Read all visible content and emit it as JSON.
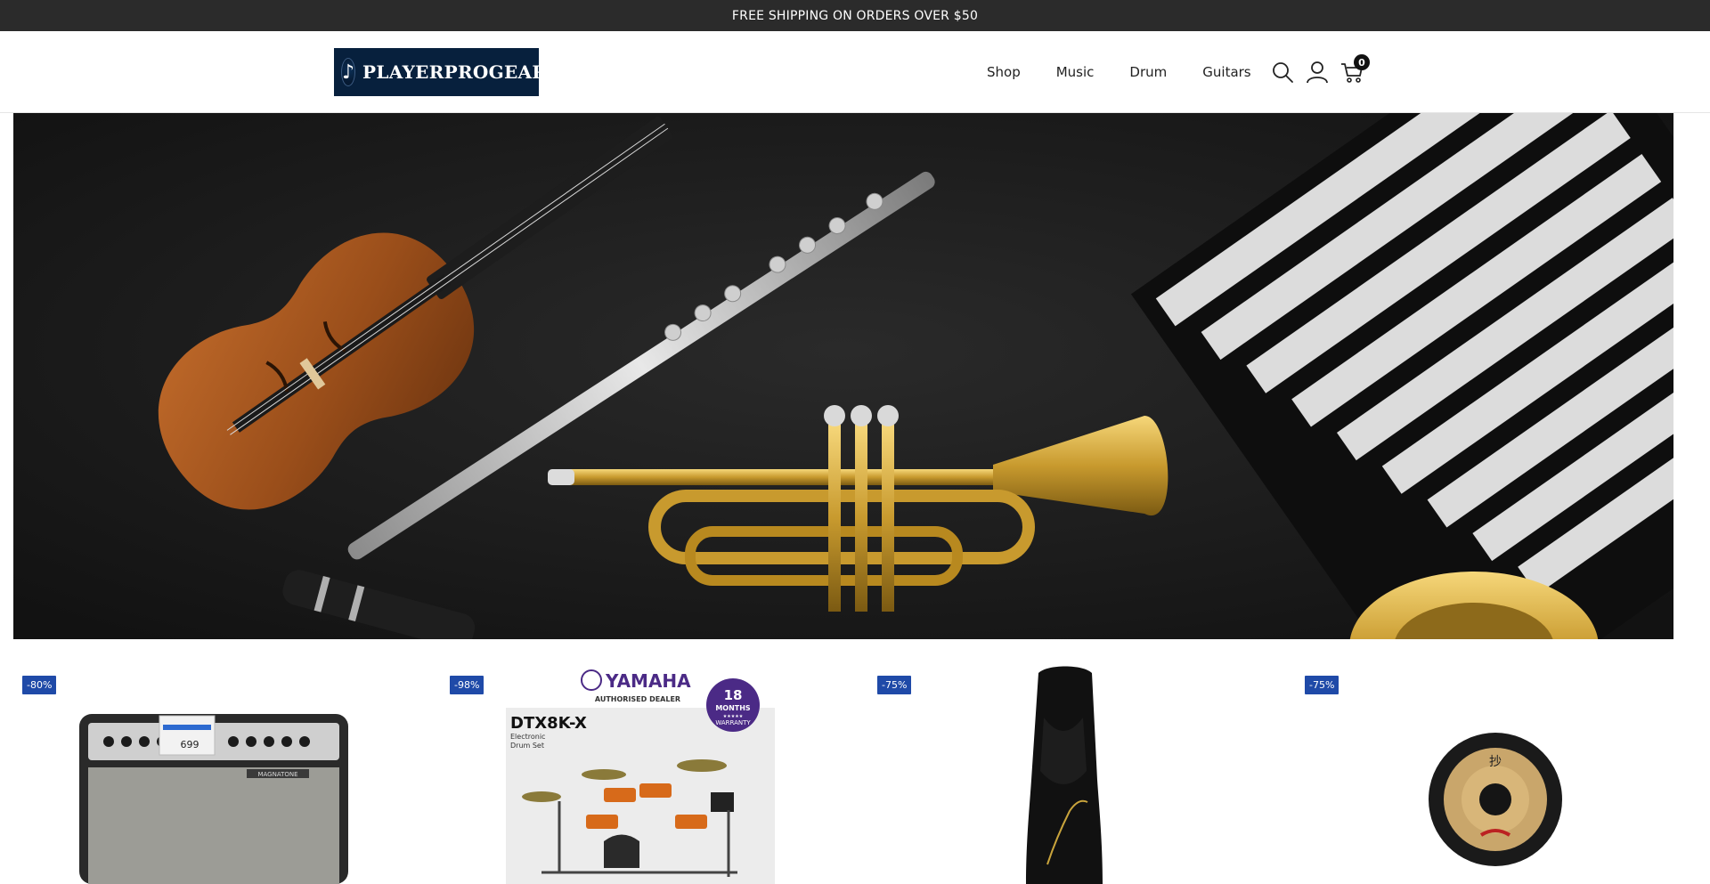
{
  "announcement": "FREE SHIPPING ON ORDERS OVER $50",
  "header": {
    "logo_text": "PLAYERPROGEAR",
    "logo_glyph": "♪",
    "nav": [
      {
        "label": "Shop"
      },
      {
        "label": "Music"
      },
      {
        "label": "Drum"
      },
      {
        "label": "Guitars"
      }
    ],
    "icons": {
      "search": "search-icon",
      "account": "user-icon",
      "cart": "cart-icon"
    },
    "cart_count": "0"
  },
  "hero": {
    "image": "musical instruments flat lay: violin, flute, trumpet, glockenspiel, saxophone, clarinet",
    "background_color": "#161616"
  },
  "products": [
    {
      "badge": "-80%",
      "image": "vintage guitar amplifier",
      "amp_brand": "MAGNATONE",
      "amp_price_tag": "699"
    },
    {
      "badge": "-98%",
      "image": "Yamaha DTX8K-X electronic drum set",
      "brand": "YAMAHA",
      "dealer": "AUTHORISED DEALER",
      "model": "DTX8K-X",
      "subtitle_1": "Electronic",
      "subtitle_2": "Drum Set",
      "warranty_top": "18",
      "warranty_mid": "MONTHS",
      "warranty_stars": "★★★★★",
      "warranty_bottom": "WARRANTY"
    },
    {
      "badge": "-75%",
      "image": "saxophone mouthpiece"
    },
    {
      "badge": "-75%",
      "image": "Meinl gong"
    }
  ],
  "colors": {
    "badge": "#1f4aa8",
    "announcement_bg": "#2b2b2b",
    "logo_bg": "#07203d",
    "yamaha_purple": "#4b2a86"
  }
}
